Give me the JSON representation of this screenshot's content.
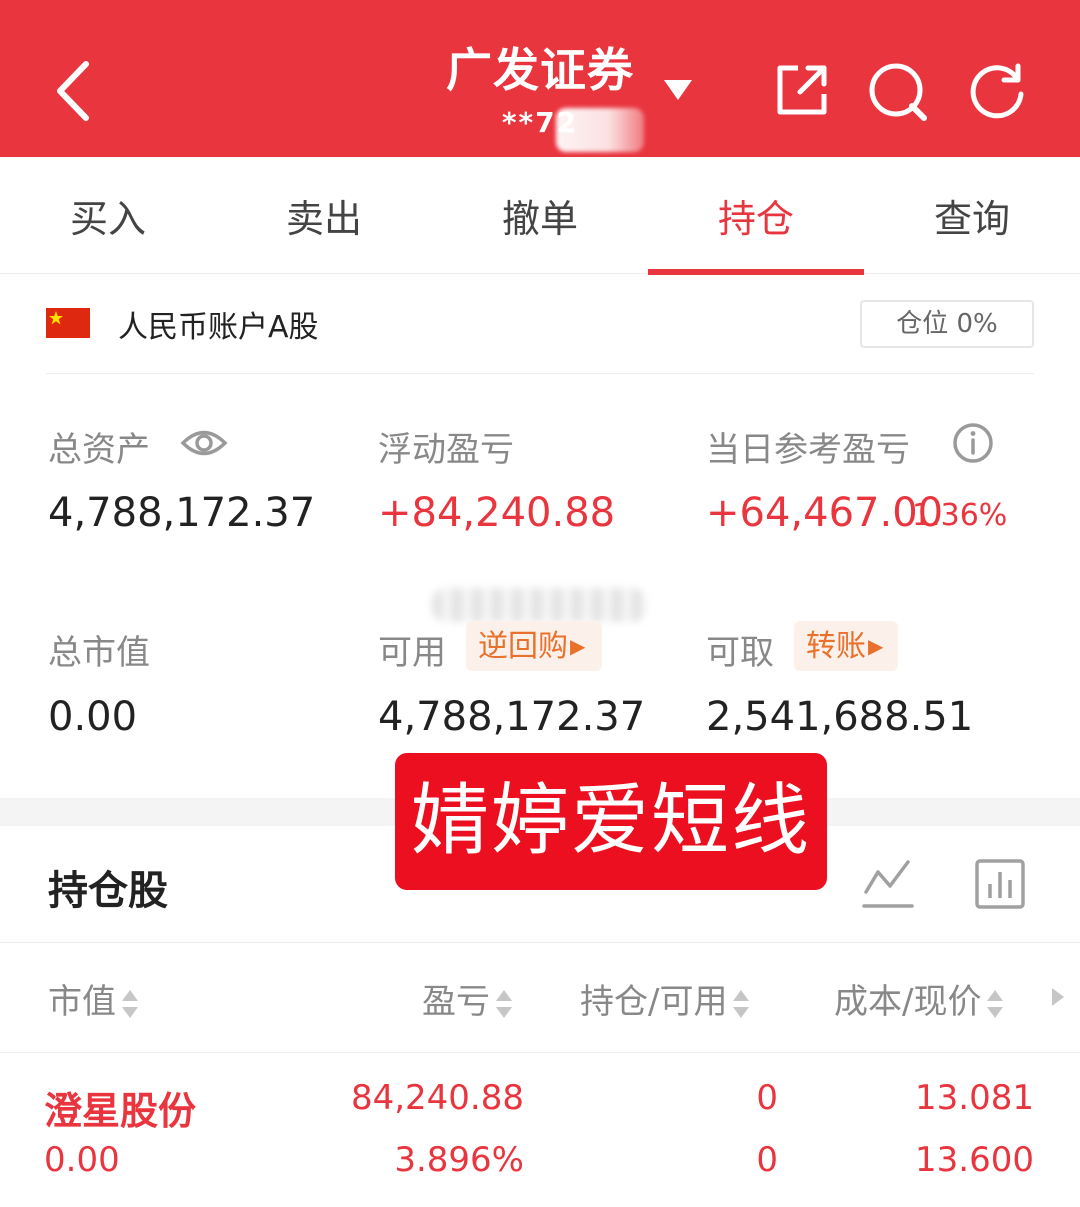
{
  "header": {
    "title": "广发证券",
    "account_masked": "**72",
    "accent": "#e9353e"
  },
  "tabs": [
    {
      "label": "买入"
    },
    {
      "label": "卖出"
    },
    {
      "label": "撤单"
    },
    {
      "label": "持仓",
      "active": true
    },
    {
      "label": "查询"
    }
  ],
  "account": {
    "label": "人民币账户A股",
    "position_ratio": "仓位 0%",
    "flag_color": "#de2910"
  },
  "stats": {
    "total_assets": {
      "label": "总资产",
      "value": "4,788,172.37"
    },
    "floating_pl": {
      "label": "浮动盈亏",
      "value": "+84,240.88"
    },
    "today_pl": {
      "label": "当日参考盈亏",
      "value": "+64,467.00",
      "percent": "1.36%"
    },
    "market_value": {
      "label": "总市值",
      "value": "0.00"
    },
    "available": {
      "label": "可用",
      "value": "4,788,172.37",
      "action": "逆回购"
    },
    "withdrawable": {
      "label": "可取",
      "value": "2,541,688.51",
      "action": "转账"
    }
  },
  "watermark": "婧婷爱短线",
  "holdings": {
    "title": "持仓股",
    "columns": [
      "市值",
      "盈亏",
      "持仓/可用",
      "成本/现价"
    ],
    "rows": [
      {
        "name": "澄星股份",
        "market_value": "0.00",
        "pl": "84,240.88",
        "pl_percent": "3.896%",
        "position": "0",
        "available": "0",
        "cost": "13.081",
        "price": "13.600"
      }
    ]
  },
  "icons": {
    "back": "chevron-left-icon",
    "dropdown": "caret-down-icon",
    "share": "share-icon",
    "search": "search-icon",
    "refresh": "refresh-icon",
    "eye": "eye-icon",
    "info": "info-icon",
    "trend": "trend-chart-icon",
    "bars": "bar-chart-icon",
    "sort": "sort-icon"
  }
}
